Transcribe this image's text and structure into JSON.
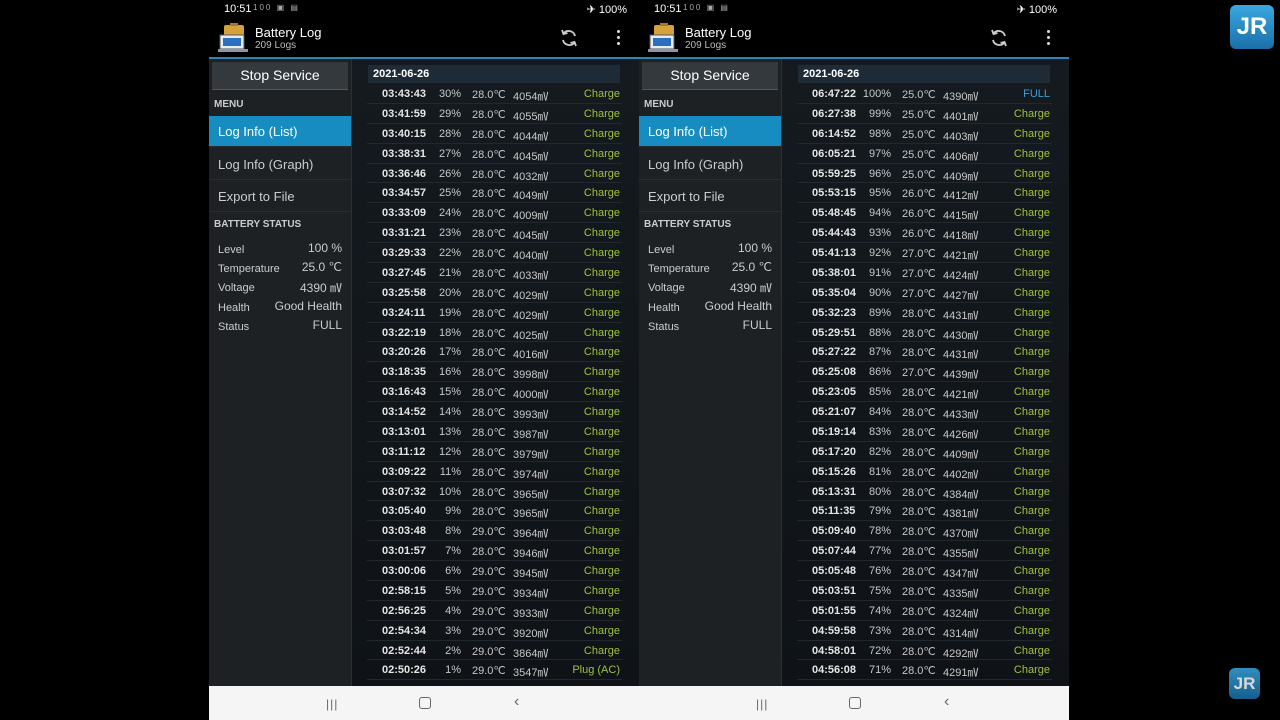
{
  "status_bar": {
    "time": "10:51",
    "icons": "100 ▣ ▤",
    "battery": "✈ 100%"
  },
  "app": {
    "title": "Battery Log",
    "subtitle": "209 Logs"
  },
  "sidebar": {
    "stop_label": "Stop Service",
    "menu_header": "MENU",
    "menu_items": [
      "Log Info (List)",
      "Log Info (Graph)",
      "Export to File"
    ],
    "battery_header": "BATTERY STATUS",
    "stats": [
      {
        "label": "Level",
        "value": "100 %"
      },
      {
        "label": "Temperature",
        "value": "25.0 ℃"
      },
      {
        "label": "Voltage",
        "value": "4390 ㎷"
      },
      {
        "label": "Health",
        "value": "Good Health"
      },
      {
        "label": "Status",
        "value": "FULL"
      }
    ]
  },
  "navbar": {
    "recent": "|||",
    "back": "‹"
  },
  "watermark": {
    "text": "JR"
  },
  "left_log": {
    "date": "2021-06-26",
    "rows": [
      [
        "03:43:43",
        "30%",
        "28.0℃",
        "4054㎷",
        "Charge"
      ],
      [
        "03:41:59",
        "29%",
        "28.0℃",
        "4055㎷",
        "Charge"
      ],
      [
        "03:40:15",
        "28%",
        "28.0℃",
        "4044㎷",
        "Charge"
      ],
      [
        "03:38:31",
        "27%",
        "28.0℃",
        "4045㎷",
        "Charge"
      ],
      [
        "03:36:46",
        "26%",
        "28.0℃",
        "4032㎷",
        "Charge"
      ],
      [
        "03:34:57",
        "25%",
        "28.0℃",
        "4049㎷",
        "Charge"
      ],
      [
        "03:33:09",
        "24%",
        "28.0℃",
        "4009㎷",
        "Charge"
      ],
      [
        "03:31:21",
        "23%",
        "28.0℃",
        "4045㎷",
        "Charge"
      ],
      [
        "03:29:33",
        "22%",
        "28.0℃",
        "4040㎷",
        "Charge"
      ],
      [
        "03:27:45",
        "21%",
        "28.0℃",
        "4033㎷",
        "Charge"
      ],
      [
        "03:25:58",
        "20%",
        "28.0℃",
        "4029㎷",
        "Charge"
      ],
      [
        "03:24:11",
        "19%",
        "28.0℃",
        "4029㎷",
        "Charge"
      ],
      [
        "03:22:19",
        "18%",
        "28.0℃",
        "4025㎷",
        "Charge"
      ],
      [
        "03:20:26",
        "17%",
        "28.0℃",
        "4016㎷",
        "Charge"
      ],
      [
        "03:18:35",
        "16%",
        "28.0℃",
        "3998㎷",
        "Charge"
      ],
      [
        "03:16:43",
        "15%",
        "28.0℃",
        "4000㎷",
        "Charge"
      ],
      [
        "03:14:52",
        "14%",
        "28.0℃",
        "3993㎷",
        "Charge"
      ],
      [
        "03:13:01",
        "13%",
        "28.0℃",
        "3987㎷",
        "Charge"
      ],
      [
        "03:11:12",
        "12%",
        "28.0℃",
        "3979㎷",
        "Charge"
      ],
      [
        "03:09:22",
        "11%",
        "28.0℃",
        "3974㎷",
        "Charge"
      ],
      [
        "03:07:32",
        "10%",
        "28.0℃",
        "3965㎷",
        "Charge"
      ],
      [
        "03:05:40",
        "9%",
        "28.0℃",
        "3965㎷",
        "Charge"
      ],
      [
        "03:03:48",
        "8%",
        "29.0℃",
        "3964㎷",
        "Charge"
      ],
      [
        "03:01:57",
        "7%",
        "28.0℃",
        "3946㎷",
        "Charge"
      ],
      [
        "03:00:06",
        "6%",
        "29.0℃",
        "3945㎷",
        "Charge"
      ],
      [
        "02:58:15",
        "5%",
        "29.0℃",
        "3934㎷",
        "Charge"
      ],
      [
        "02:56:25",
        "4%",
        "29.0℃",
        "3933㎷",
        "Charge"
      ],
      [
        "02:54:34",
        "3%",
        "29.0℃",
        "3920㎷",
        "Charge"
      ],
      [
        "02:52:44",
        "2%",
        "29.0℃",
        "3864㎷",
        "Charge"
      ],
      [
        "02:50:26",
        "1%",
        "29.0℃",
        "3547㎷",
        "Plug (AC)"
      ]
    ]
  },
  "right_log": {
    "date": "2021-06-26",
    "rows": [
      [
        "06:47:22",
        "100%",
        "25.0℃",
        "4390㎷",
        "FULL"
      ],
      [
        "06:27:38",
        "99%",
        "25.0℃",
        "4401㎷",
        "Charge"
      ],
      [
        "06:14:52",
        "98%",
        "25.0℃",
        "4403㎷",
        "Charge"
      ],
      [
        "06:05:21",
        "97%",
        "25.0℃",
        "4406㎷",
        "Charge"
      ],
      [
        "05:59:25",
        "96%",
        "25.0℃",
        "4409㎷",
        "Charge"
      ],
      [
        "05:53:15",
        "95%",
        "26.0℃",
        "4412㎷",
        "Charge"
      ],
      [
        "05:48:45",
        "94%",
        "26.0℃",
        "4415㎷",
        "Charge"
      ],
      [
        "05:44:43",
        "93%",
        "26.0℃",
        "4418㎷",
        "Charge"
      ],
      [
        "05:41:13",
        "92%",
        "27.0℃",
        "4421㎷",
        "Charge"
      ],
      [
        "05:38:01",
        "91%",
        "27.0℃",
        "4424㎷",
        "Charge"
      ],
      [
        "05:35:04",
        "90%",
        "27.0℃",
        "4427㎷",
        "Charge"
      ],
      [
        "05:32:23",
        "89%",
        "28.0℃",
        "4431㎷",
        "Charge"
      ],
      [
        "05:29:51",
        "88%",
        "28.0℃",
        "4430㎷",
        "Charge"
      ],
      [
        "05:27:22",
        "87%",
        "28.0℃",
        "4431㎷",
        "Charge"
      ],
      [
        "05:25:08",
        "86%",
        "27.0℃",
        "4439㎷",
        "Charge"
      ],
      [
        "05:23:05",
        "85%",
        "28.0℃",
        "4421㎷",
        "Charge"
      ],
      [
        "05:21:07",
        "84%",
        "28.0℃",
        "4433㎷",
        "Charge"
      ],
      [
        "05:19:14",
        "83%",
        "28.0℃",
        "4426㎷",
        "Charge"
      ],
      [
        "05:17:20",
        "82%",
        "28.0℃",
        "4409㎷",
        "Charge"
      ],
      [
        "05:15:26",
        "81%",
        "28.0℃",
        "4402㎷",
        "Charge"
      ],
      [
        "05:13:31",
        "80%",
        "28.0℃",
        "4384㎷",
        "Charge"
      ],
      [
        "05:11:35",
        "79%",
        "28.0℃",
        "4381㎷",
        "Charge"
      ],
      [
        "05:09:40",
        "78%",
        "28.0℃",
        "4370㎷",
        "Charge"
      ],
      [
        "05:07:44",
        "77%",
        "28.0℃",
        "4355㎷",
        "Charge"
      ],
      [
        "05:05:48",
        "76%",
        "28.0℃",
        "4347㎷",
        "Charge"
      ],
      [
        "05:03:51",
        "75%",
        "28.0℃",
        "4335㎷",
        "Charge"
      ],
      [
        "05:01:55",
        "74%",
        "28.0℃",
        "4324㎷",
        "Charge"
      ],
      [
        "04:59:58",
        "73%",
        "28.0℃",
        "4314㎷",
        "Charge"
      ],
      [
        "04:58:01",
        "72%",
        "28.0℃",
        "4292㎷",
        "Charge"
      ],
      [
        "04:56:08",
        "71%",
        "28.0℃",
        "4291㎷",
        "Charge"
      ]
    ]
  }
}
